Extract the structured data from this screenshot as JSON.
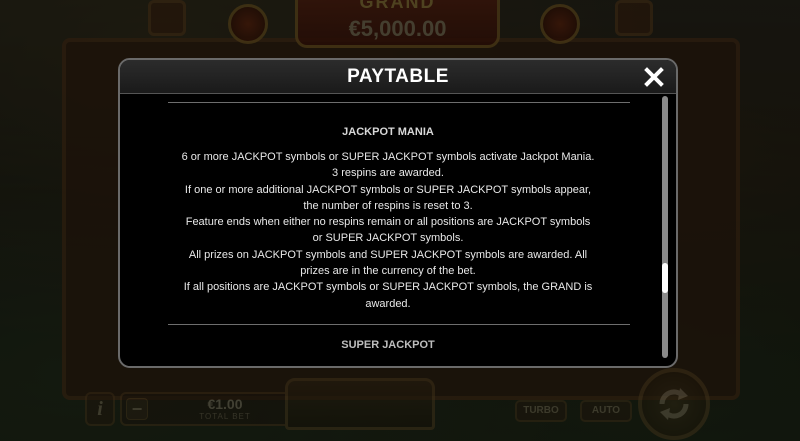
{
  "background": {
    "jackpot_title": "GRAND",
    "jackpot_amount": "€5,000.00",
    "bet_value": "€1.00",
    "bet_caption": "TOTAL BET",
    "turbo_label": "TURBO",
    "auto_label": "AUTO",
    "info_label": "i",
    "minus_label": "−",
    "plus_label": "+"
  },
  "modal": {
    "title": "PAYTABLE",
    "close_icon": "close-icon",
    "section_title": "JACKPOT MANIA",
    "lines": [
      "6 or more JACKPOT symbols or SUPER JACKPOT symbols activate Jackpot Mania.",
      "3 respins are awarded.",
      "If one or more additional JACKPOT symbols or SUPER JACKPOT symbols appear,",
      "the number of respins is reset to 3.",
      "Feature ends when either no respins remain or all positions are JACKPOT symbols",
      "or SUPER JACKPOT symbols.",
      "All prizes on JACKPOT symbols and SUPER JACKPOT symbols are awarded. All",
      "prizes are in the currency of the bet.",
      "If all positions are JACKPOT symbols or SUPER JACKPOT symbols, the GRAND is",
      "awarded."
    ],
    "next_section_title": "SUPER JACKPOT",
    "scroll_position": 0.72
  },
  "colors": {
    "modal_bg": "#000000",
    "modal_border": "#6a6a6a",
    "text": "#e8e8e8"
  }
}
